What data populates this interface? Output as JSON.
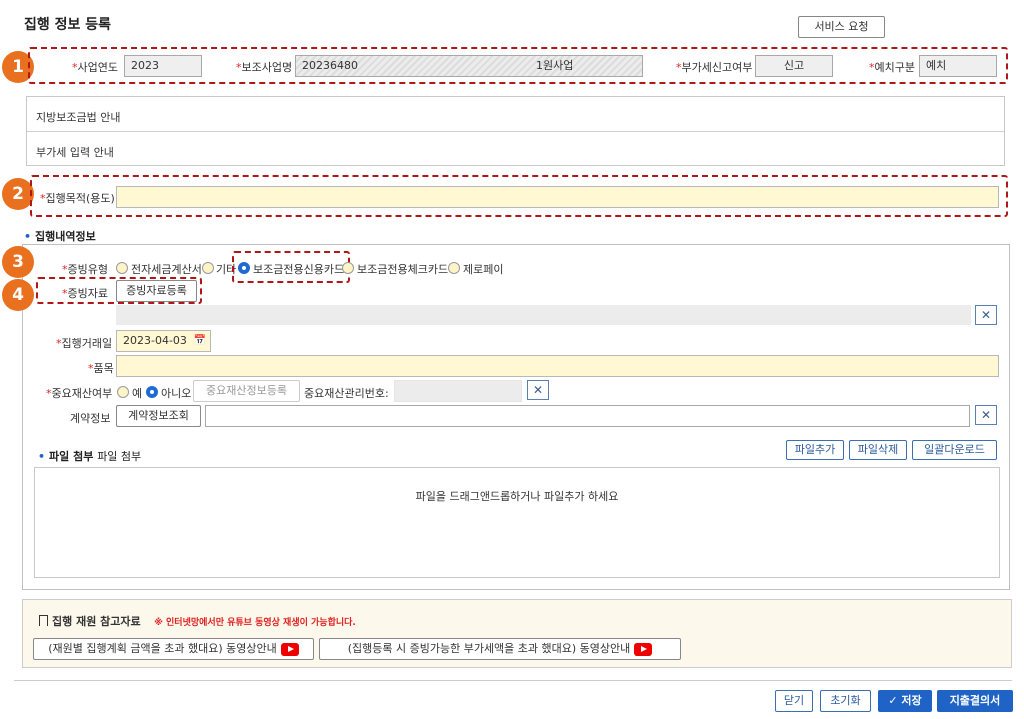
{
  "page_title": "집행 정보 등록",
  "service_request": "서비스 요청",
  "markers": [
    "1",
    "2",
    "3",
    "4"
  ],
  "required_mark": "*",
  "header": {
    "year_label": "사업연도",
    "year_value": "2023",
    "project_label": "보조사업명",
    "project_code": "20236480",
    "project_name": "1원사업",
    "vat_label": "부가세신고여부",
    "vat_value": "신고",
    "deposit_label": "예치구분",
    "deposit_value": "예치"
  },
  "guides": [
    "지방보조금법 안내",
    "부가세 입력 안내"
  ],
  "purpose_label": "집행목적(용도)",
  "section_title": "집행내역정보",
  "proof_type": {
    "label": "증빙유형",
    "options": [
      "전자세금계산서",
      "기타",
      "보조금전용신용카드",
      "보조금전용체크카드",
      "제로페이"
    ],
    "selected": 2
  },
  "proof_doc": {
    "label": "증빙자료",
    "button": "증빙자료등록"
  },
  "clear_icon": "✕",
  "calendar_icon": "📅",
  "exec_date": {
    "label": "집행거래일",
    "value": "2023-04-03"
  },
  "item_label": "품목",
  "asset": {
    "label": "중요재산여부",
    "yes": "예",
    "no": "아니오",
    "reg_button": "중요재산정보등록",
    "mgmt_label": "중요재산관리번호:"
  },
  "contract": {
    "label": "계약정보",
    "button": "계약정보조회"
  },
  "attach": {
    "title": "파일 첨부",
    "subtitle": "파일 첨부",
    "add": "파일추가",
    "delete": "파일삭제",
    "download": "일괄다운로드",
    "drop_text": "파일을 드래그앤드롭하거나  파일추가 하세요"
  },
  "reference": {
    "title": "집행 재원 참고자료",
    "notice": "※ 인터넷망에서만 유튜브 동영상 재생이 가능합니다.",
    "video1": "(재원별 집행계획 금액을 초과 했대요) 동영상안내",
    "video2": "(집행등록 시 증빙가능한 부가세액을 초과 했대요) 동영상안내"
  },
  "footer": {
    "close": "닫기",
    "reset": "초기화",
    "save": "✓ 저장",
    "submit": "지출결의서"
  },
  "colors": {
    "marker": "#e8701e",
    "dash": "#b01818",
    "primary": "#1f63c6",
    "highlight": "#fff8d2"
  }
}
